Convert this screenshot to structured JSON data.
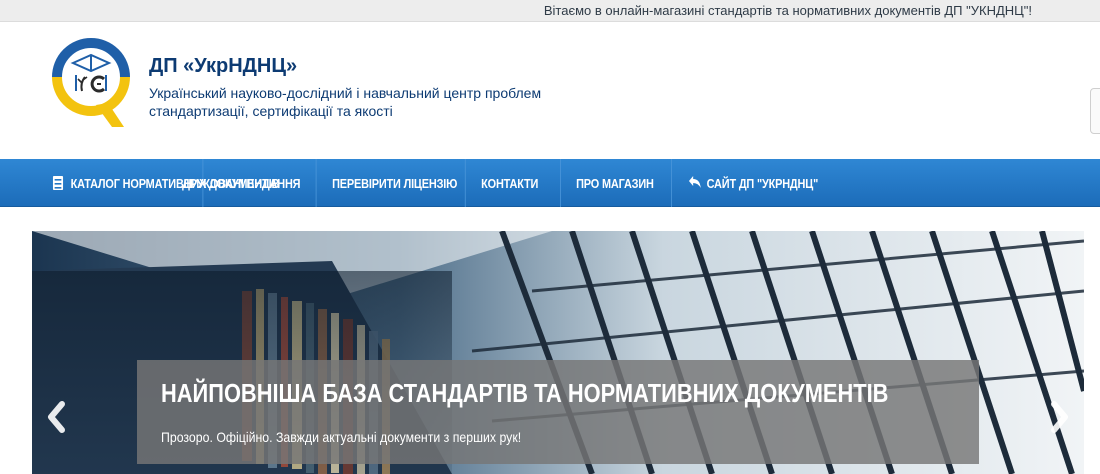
{
  "topbar": {
    "welcome": "Вітаємо в онлайн-магазині стандартів та нормативних документів ДП \"УКНДНЦ\"!"
  },
  "header": {
    "brand_title": "ДП «УкрНДНЦ»",
    "brand_subtitle": "Український науково-дослідний і навчальний центр проблем стандартизації, сертифікації та якості"
  },
  "nav": {
    "items": [
      {
        "label": "КАТАЛОГ НОРМАТИВНИХ ДОКУМЕНТІВ",
        "icon": "catalog-icon"
      },
      {
        "label": "ДРУКОВАНІ ВИДАННЯ"
      },
      {
        "label": "ПЕРЕВІРИТИ ЛІЦЕНЗІЮ"
      },
      {
        "label": "КОНТАКТИ"
      },
      {
        "label": "ПРО МАГАЗИН"
      },
      {
        "label": "САЙТ ДП \"УКРНДНЦ\"",
        "icon": "reply-arrow-icon"
      }
    ]
  },
  "banner": {
    "title": "НАЙПОВНІША БАЗА СТАНДАРТІВ ТА НОРМАТИВНИХ ДОКУМЕНТІВ",
    "text": "Прозоро. Офіційно. Завжди актуальні документи з перших рук!",
    "prev_icon": "chevron-left-icon",
    "next_icon": "chevron-right-icon"
  },
  "colors": {
    "nav_bg": "#2378c6",
    "brand_text": "#0d3b73",
    "logo_blue": "#1f5fa8",
    "logo_yellow": "#f3c30f"
  }
}
